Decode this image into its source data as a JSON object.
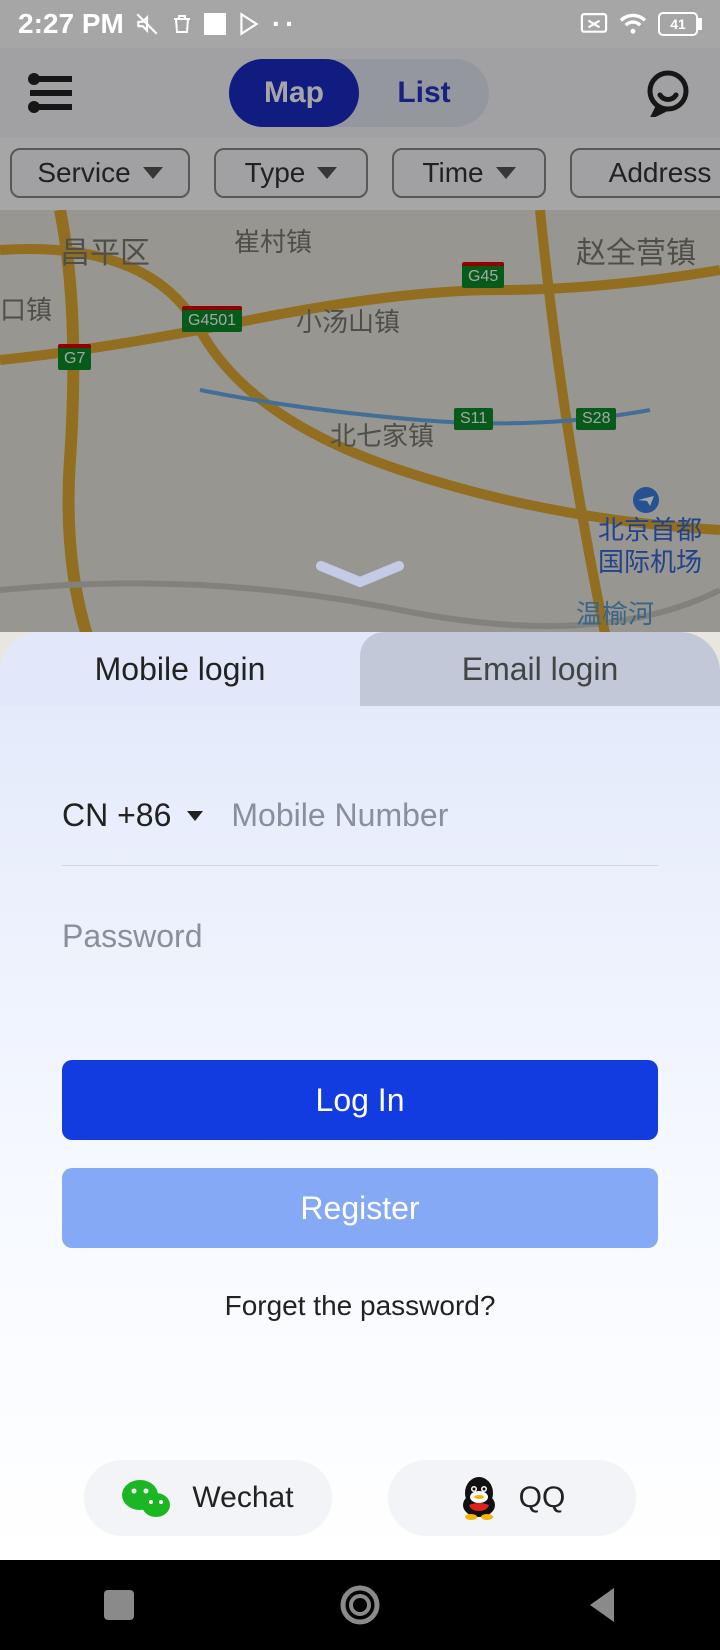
{
  "status": {
    "time": "2:27 PM",
    "battery": "41"
  },
  "nav": {
    "map": "Map",
    "list": "List"
  },
  "filters": [
    "Service",
    "Type",
    "Time",
    "Address"
  ],
  "map_labels": {
    "changping": "昌平区",
    "cuicun": "崔村镇",
    "zhaoquan": "赵全营镇",
    "koutown": "口镇",
    "xiaotang": "小汤山镇",
    "beiqijia": "北七家镇",
    "airport1": "北京首都",
    "airport2": "国际机场",
    "wenyu": "温榆河",
    "g45": "G45",
    "g4501": "G4501",
    "g7": "G7",
    "s11": "S11",
    "s28": "S28"
  },
  "login": {
    "tab_mobile": "Mobile login",
    "tab_email": "Email login",
    "country": "CN +86",
    "mobile_placeholder": "Mobile Number",
    "password_placeholder": "Password",
    "login_btn": "Log In",
    "register_btn": "Register",
    "forgot": "Forget the password?",
    "wechat": "Wechat",
    "qq": "QQ"
  }
}
